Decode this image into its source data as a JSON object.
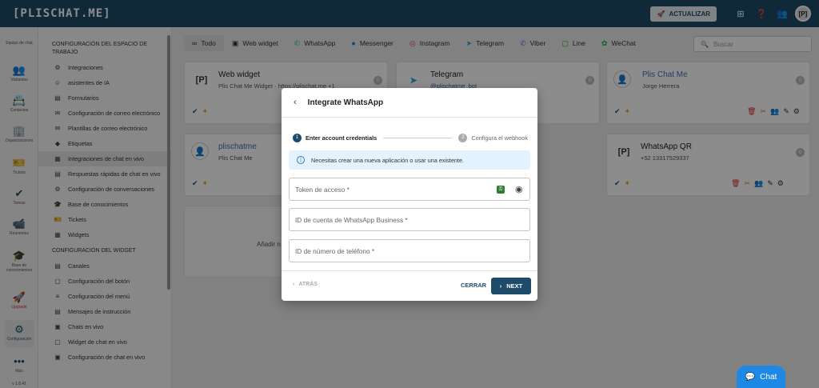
{
  "app": {
    "logo": "[PLISCHAT.ME]"
  },
  "topbar": {
    "upgrade_label": "ACTUALIZAR",
    "avatar_initials": "[P]"
  },
  "rail": {
    "items": [
      {
        "label": "Equipo de chat",
        "icon": "people-icon"
      },
      {
        "label": "Visitantes",
        "icon": "group-icon"
      },
      {
        "label": "Contactos",
        "icon": "contacts-icon"
      },
      {
        "label": "Organizaciones",
        "icon": "building-icon"
      },
      {
        "label": "Tickets",
        "icon": "ticket-icon"
      },
      {
        "label": "Tareas",
        "icon": "check-circle-icon"
      },
      {
        "label": "Reuniones",
        "icon": "video-icon"
      },
      {
        "label": "Base de conocimientos",
        "icon": "book-icon"
      },
      {
        "label": "Upgrade",
        "icon": "rocket-icon"
      },
      {
        "label": "Configuración",
        "icon": "gear-icon"
      },
      {
        "label": "Más",
        "icon": "more-icon"
      },
      {
        "label": "v 1.8.41",
        "icon": ""
      }
    ]
  },
  "menu": {
    "section1": "CONFIGURACIÓN DEL ESPACIO DE TRABAJO",
    "items1": [
      "Integraciones",
      "asistentes de IA",
      "Formularios",
      "Configuración de correo electrónico",
      "Plantillas de correo electrónico",
      "Etiquetas",
      "Integraciones de chat en vivo",
      "Respuestas rápidas de chat en vivo",
      "Configuración de conversaciones",
      "Base de conocimientos",
      "Tickets",
      "Widgets"
    ],
    "section2": "CONFIGURACIÓN DEL WIDGET",
    "items2": [
      "Canales",
      "Configuración del botón",
      "Configuración del menú",
      "Mensajes de instrucción",
      "Chats en vivo",
      "Widget de chat en vivo",
      "Configuración de chat en vivo"
    ]
  },
  "tabs": [
    "Todo",
    "Web widget",
    "WhatsApp",
    "Messenger",
    "Instagram",
    "Telegram",
    "Viber",
    "Line",
    "WeChat"
  ],
  "search": {
    "placeholder": "Buscar"
  },
  "cards": [
    {
      "title": "Web widget",
      "subtitle": "Plis Chat Me Widget · https://plischat.me +1",
      "count": "0"
    },
    {
      "title": "Telegram",
      "subtitle": "@plischatme_bot",
      "count": "0"
    },
    {
      "title": "Plis Chat Me",
      "subtitle": "Jorge Herrera",
      "count": "0"
    },
    {
      "title": "plischatme",
      "subtitle": "Plis Chat Me",
      "count": "0"
    },
    {
      "title": "WhatsApp QR",
      "subtitle": "+52 13317529337",
      "count": "0"
    }
  ],
  "empty_hint": "Añadir n",
  "modal": {
    "title": "Integrate WhatsApp",
    "step1_num": "1",
    "step1_label": "Enter account credentials",
    "step2_num": "2",
    "step2_label": "Configura el webhook",
    "info": "Necesitas crear una nueva aplicación o usar una existente.",
    "field_token": "Token de acceso *",
    "field_business": "ID de cuenta de WhatsApp Business *",
    "field_phone": "ID de número de teléfono *",
    "back_label": "ATRÁS",
    "close_label": "CERRAR",
    "next_label": "NEXT"
  },
  "chat_button": "Chat",
  "colors": {
    "primary": "#1d4b69",
    "accent": "#1e88e5",
    "info_bg": "#e3f2fd"
  }
}
